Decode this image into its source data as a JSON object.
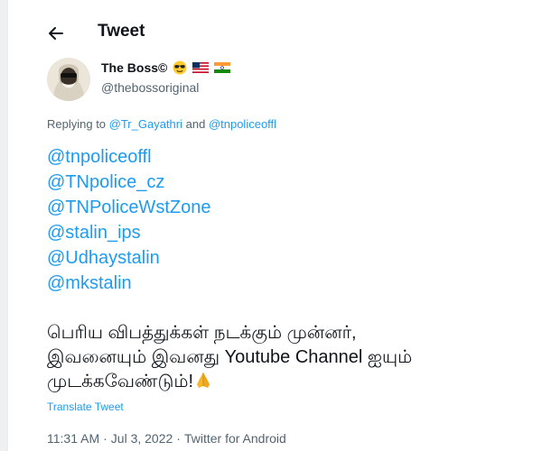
{
  "header": {
    "title": "Tweet"
  },
  "author": {
    "display_name": "The Boss©",
    "handle": "@thebossoriginal"
  },
  "replying": {
    "prefix": "Replying to ",
    "user1": "@Tr_Gayathri",
    "conjunction": " and ",
    "user2": "@tnpoliceoffl"
  },
  "mentions": [
    "@tnpoliceoffl",
    "@TNpolice_cz",
    "@TNPoliceWstZone",
    "@stalin_ips",
    "@Udhaystalin",
    "@mkstalin"
  ],
  "tweet": {
    "line1": "பெரிய விபத்துக்கள் நடக்கும் முன்னர்,",
    "line2": "இவனையும் இவனது Youtube Channel ஐயும்",
    "line3": "முடக்கவேண்டும்!"
  },
  "translate_label": "Translate Tweet",
  "meta": {
    "time": "11:31 AM",
    "date": "Jul 3, 2022",
    "source": "Twitter for Android",
    "separator": "·"
  },
  "colors": {
    "link": "#1d9bf0",
    "text": "#0f1419",
    "secondary": "#536471"
  },
  "icons": [
    "back-arrow-icon",
    "sunglasses-emoji-icon",
    "us-flag-icon",
    "india-flag-icon",
    "folded-hands-emoji-icon"
  ]
}
